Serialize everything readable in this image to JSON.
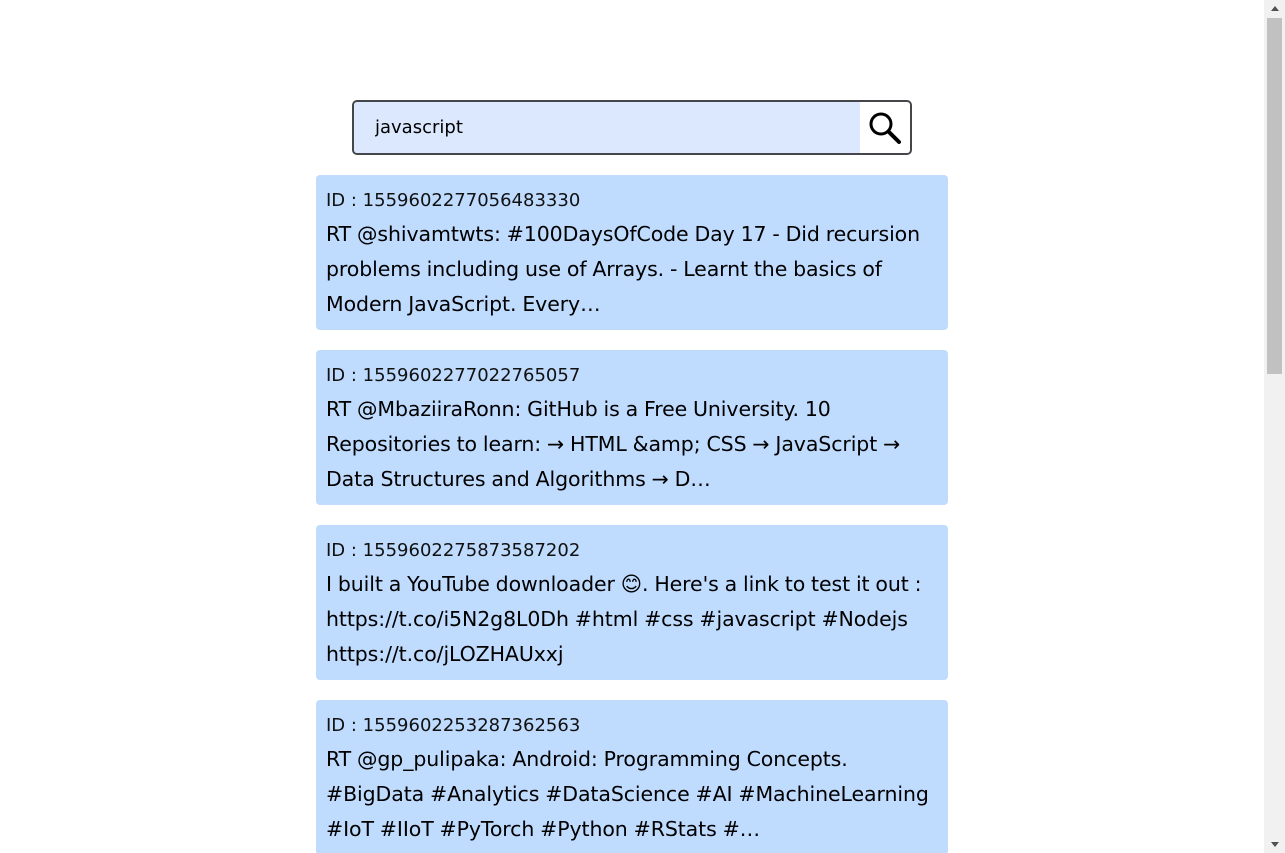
{
  "search": {
    "value": "javascript",
    "placeholder": "",
    "button_icon": "search-icon"
  },
  "results": [
    {
      "id_label": "ID : 1559602277056483330",
      "text": "RT @shivamtwts: #100DaysOfCode Day 17 - Did recursion problems including use of Arrays. - Learnt the basics of Modern JavaScript. Every…"
    },
    {
      "id_label": "ID : 1559602277022765057",
      "text": "RT @MbaziiraRonn: GitHub is a Free University. 10 Repositories to learn: → HTML &amp; CSS → JavaScript → Data Structures and Algorithms → D…"
    },
    {
      "id_label": "ID : 1559602275873587202",
      "text": "I built a YouTube downloader 😊. Here's a link to test it out : https://t.co/i5N2g8L0Dh #html #css #javascript #Nodejs https://t.co/jLOZHAUxxj"
    },
    {
      "id_label": "ID : 1559602253287362563",
      "text": "RT @gp_pulipaka: Android: Programming Concepts. #BigData #Analytics #DataScience #AI #MachineLearning #IoT #IIoT #PyTorch #Python #RStats #…"
    }
  ],
  "colors": {
    "card_background": "#bfdbfe",
    "input_background": "#dbe8fe",
    "border": "#44464a"
  }
}
